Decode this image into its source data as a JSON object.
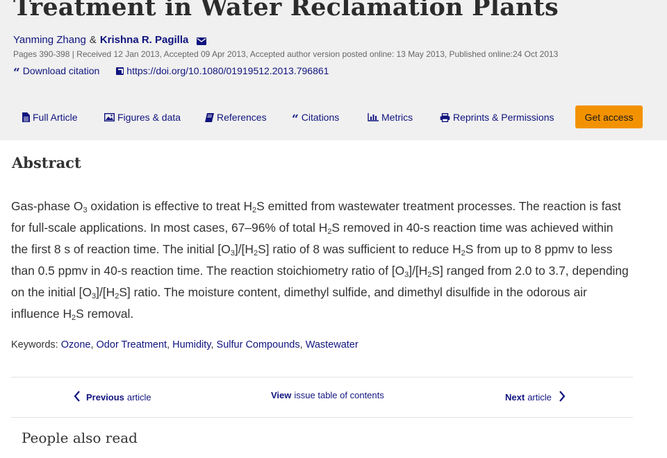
{
  "article": {
    "title": "Treatment in Water Reclamation Plants",
    "author1": "Yanming Zhang",
    "amp": "&",
    "author2": "Krishna R. Pagilla",
    "pubinfo": "Pages 390-398 | Received 12 Jan 2013, Accepted 09 Apr 2013, Accepted author version posted online: 13 May 2013, Published online:24 Oct 2013",
    "download_citation": "Download citation",
    "doi": "https://doi.org/10.1080/01919512.2013.796861"
  },
  "tabs": {
    "full_article": "Full Article",
    "figures": "Figures & data",
    "references": "References",
    "citations": "Citations",
    "metrics": "Metrics",
    "reprints": "Reprints & Permissions",
    "get_access": "Get access"
  },
  "abstract": {
    "heading": "Abstract",
    "text": {
      "p1": "Gas-phase O",
      "s1": "3",
      "p2": " oxidation is effective to treat H",
      "s2": "2",
      "p3": "S emitted from wastewater treatment processes. The reaction is fast for full-scale applications. In most cases, 67–96% of total H",
      "s3": "2",
      "p4": "S removed in 40-s reaction time was achieved within the first 8 s of reaction time. The initial [O",
      "s4": "3",
      "p5": "]/[H",
      "s5": "2",
      "p6": "S] ratio of 8 was sufficient to reduce H",
      "s6": "2",
      "p7": "S from up to 8 ppmv to less than 0.5 ppmv in 40-s reaction time. The reaction stoichiometry ratio of [O",
      "s7": "3",
      "p8": "]/[H",
      "s8": "2",
      "p9": "S] ranged from 2.0 to 3.7, depending on the initial [O",
      "s9": "3",
      "p10": "]/[H",
      "s10": "2",
      "p11": "S] ratio. The moisture content, dimethyl sulfide, and dimethyl disulfide in the odorous air influence H",
      "s11": "2",
      "p12": "S removal."
    }
  },
  "keywords": {
    "label": "Keywords: ",
    "items": [
      "Ozone",
      "Odor Treatment",
      "Humidity",
      "Sulfur Compounds",
      "Wastewater"
    ],
    "separator": ", "
  },
  "nav": {
    "previous_bold": "Previous",
    "previous_rest": "article",
    "view_bold": "View",
    "view_rest": "issue table of contents",
    "next_bold": "Next",
    "next_rest": "article"
  },
  "people_also_read": "People also read",
  "colors": {
    "link": "#10147e",
    "accent": "#f39200",
    "header_bg": "#f0f0f0"
  }
}
